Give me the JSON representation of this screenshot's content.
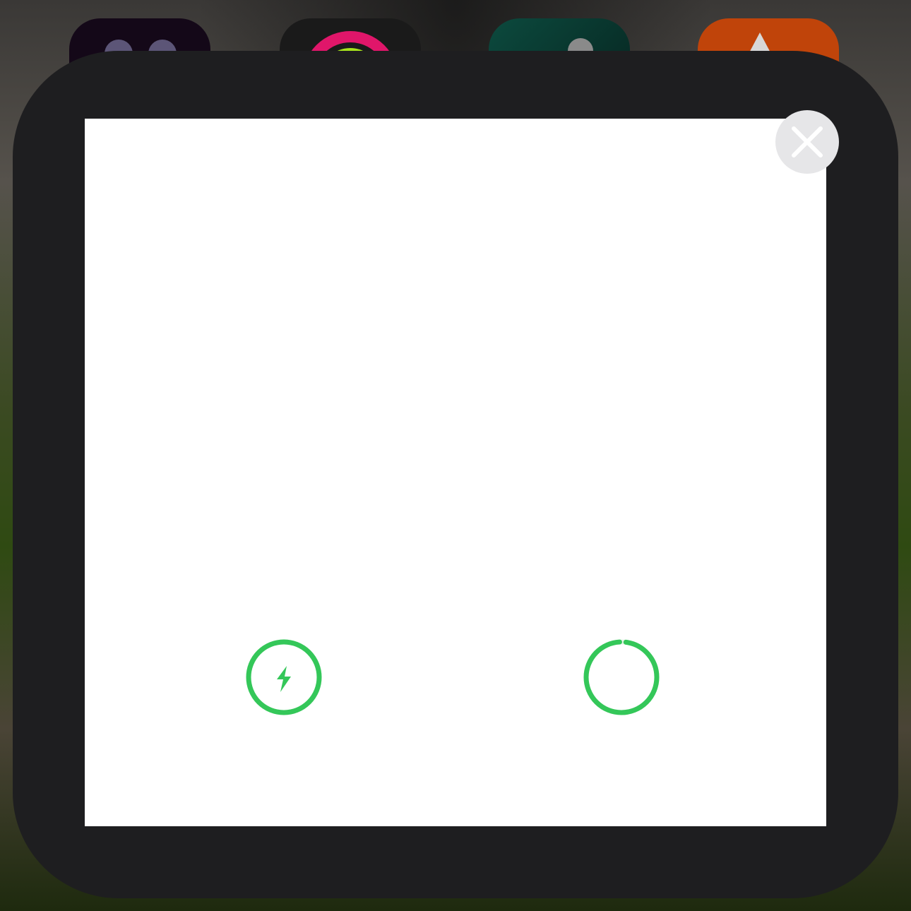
{
  "colors": {
    "ring_green": "#34c759",
    "frame": "#1e1e20",
    "card": "#ffffff",
    "close_bg": "#e6e6e8",
    "close_x": "#ffffff"
  },
  "background_apps": [
    {
      "icon": "dual-dot-app-icon"
    },
    {
      "icon": "activity-rings-app-icon"
    },
    {
      "icon": "toggle-app-icon"
    },
    {
      "icon": "arrow-app-icon"
    }
  ],
  "widget": {
    "close_icon": "close-icon",
    "devices": [
      {
        "icon": "charging-bolt-icon",
        "charging": true,
        "level": 1.0
      },
      {
        "icon": "battery-ring-icon",
        "charging": false,
        "level": 0.97
      }
    ]
  }
}
